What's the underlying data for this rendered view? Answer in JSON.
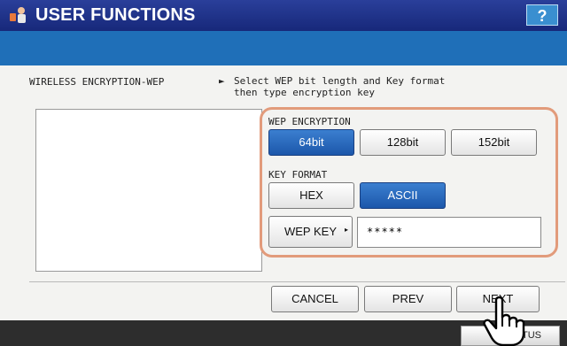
{
  "header": {
    "title": "USER FUNCTIONS",
    "help_label": "?"
  },
  "section": {
    "label": "WIRELESS ENCRYPTION-WEP",
    "instruction_arrow": "►",
    "instruction": "Select WEP bit length and Key format\nthen type encryption key"
  },
  "wep_encryption": {
    "label": "WEP ENCRYPTION",
    "options": [
      "64bit",
      "128bit",
      "152bit"
    ],
    "selected": "64bit"
  },
  "key_format": {
    "label": "KEY FORMAT",
    "options": [
      "HEX",
      "ASCII"
    ],
    "selected": "ASCII"
  },
  "wep_key": {
    "button_label": "WEP KEY",
    "value": "*****"
  },
  "footer": {
    "cancel_label": "CANCEL",
    "prev_label": "PREV",
    "next_label": "NEXT",
    "status_label": "TUS"
  },
  "colors": {
    "title_bar": "#17287a",
    "blue_bar": "#1f6fb8",
    "selected": "#1c57aa",
    "highlight": "#e29b7b"
  }
}
